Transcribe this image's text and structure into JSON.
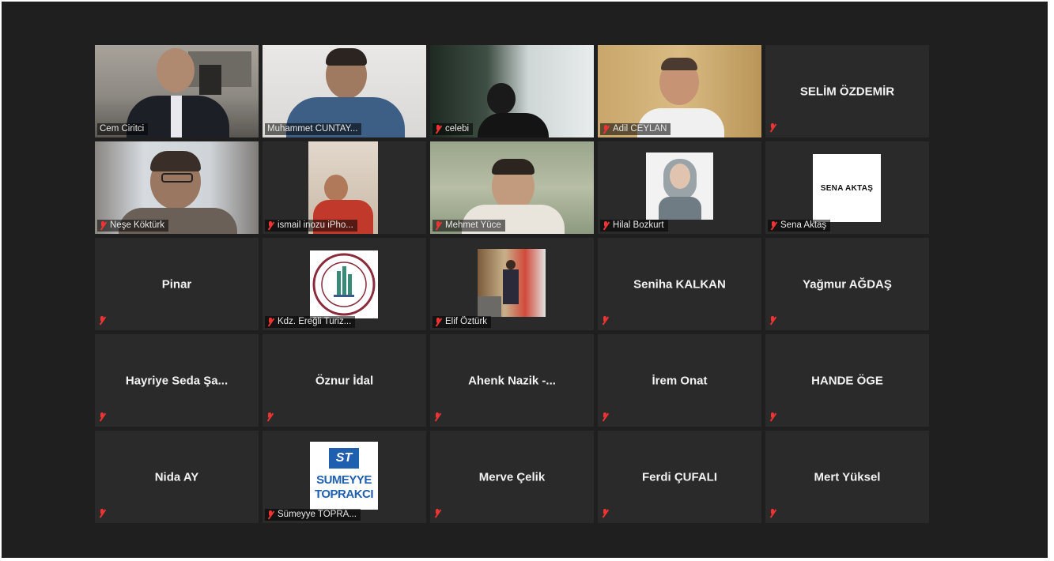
{
  "meeting": {
    "participants": [
      {
        "name": "Cem Ciritci"
      },
      {
        "name": "Muhammet CUNTAY..."
      },
      {
        "name": "celebi"
      },
      {
        "name": "Adil CEYLAN"
      },
      {
        "name": "SELİM ÖZDEMİR"
      },
      {
        "name": "Neşe Köktürk"
      },
      {
        "name": "ismail inozu iPho..."
      },
      {
        "name": "Mehmet Yüce"
      },
      {
        "name": "Hilal Bozkurt"
      },
      {
        "name": "Sena Aktaş",
        "card_text": "SENA AKTAŞ"
      },
      {
        "name": "Pinar"
      },
      {
        "name": "Kdz. Ereğli Turiz..."
      },
      {
        "name": "Elif Öztürk"
      },
      {
        "name": "Seniha KALKAN"
      },
      {
        "name": "Yağmur AĞDAŞ"
      },
      {
        "name": "Hayriye Seda Şa..."
      },
      {
        "name": "Öznur İdal"
      },
      {
        "name": "Ahenk Nazik -..."
      },
      {
        "name": "İrem Onat"
      },
      {
        "name": "HANDE ÖGE"
      },
      {
        "name": "Nida AY"
      },
      {
        "name": "Sümeyye TOPRA...",
        "logo_text": [
          "ST",
          "SUMEYYE",
          "TOPRAKCI"
        ]
      },
      {
        "name": "Merve Çelik"
      },
      {
        "name": "Ferdi ÇUFALI"
      },
      {
        "name": "Mert Yüksel"
      }
    ]
  },
  "colors": {
    "background": "#1f1f1f",
    "tile": "#2a2a2a",
    "active_speaker": "#c6e08a",
    "muted_icon": "#ee3333"
  }
}
